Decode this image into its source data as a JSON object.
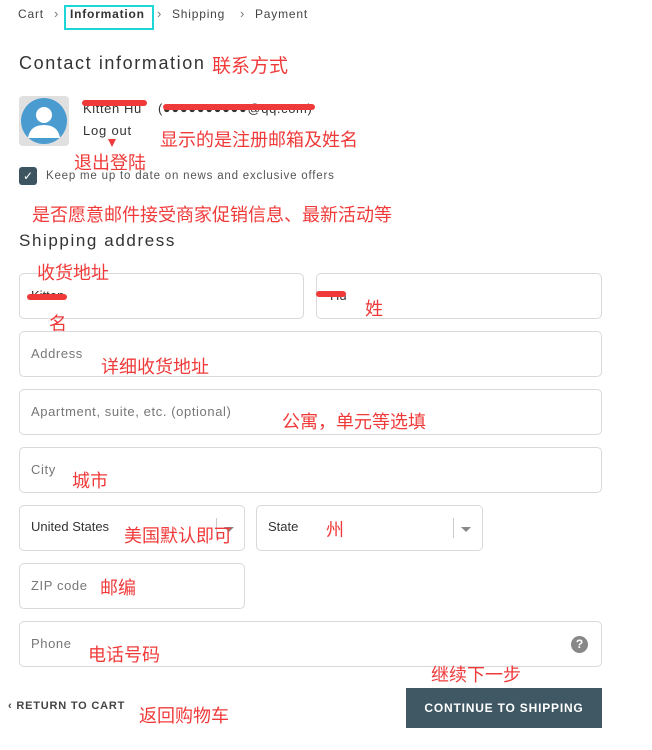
{
  "breadcrumb": {
    "items": [
      "Cart",
      "Information",
      "Shipping",
      "Payment"
    ],
    "current": "Information"
  },
  "contact": {
    "title": "Contact information",
    "name": "Kitten Hu",
    "email": "(●●●●●●●●●●@qq.com)",
    "logout": "Log out",
    "newsletter_label": "Keep me up to date on news and exclusive offers",
    "newsletter_checked": true
  },
  "shipping": {
    "title": "Shipping address",
    "first_name": "Kitten",
    "last_name": "Hu",
    "address_placeholder": "Address",
    "apartment_placeholder": "Apartment, suite, etc. (optional)",
    "city_placeholder": "City",
    "country": "United States",
    "state_placeholder": "State",
    "zip_placeholder": "ZIP code",
    "phone_placeholder": "Phone"
  },
  "actions": {
    "return_label": "RETURN TO CART",
    "continue_label": "CONTINUE TO SHIPPING"
  },
  "annotations": {
    "contact": "联系方式",
    "registered": "显示的是注册邮箱及姓名",
    "logout": "退出登陆",
    "newsletter": "是否愿意邮件接受商家促销信息、最新活动等",
    "shipping": "收货地址",
    "first_name": "名",
    "last_name": "姓",
    "address": "详细收货地址",
    "apartment": "公寓，单元等选填",
    "city": "城市",
    "country": "美国默认即可",
    "state": "州",
    "zip": "邮编",
    "phone": "电话号码",
    "continue": "继续下一步",
    "return": "返回购物车"
  },
  "colors": {
    "accent": "#3f5863",
    "annotation": "#f03a3a",
    "highlight": "#1fd6d6"
  }
}
